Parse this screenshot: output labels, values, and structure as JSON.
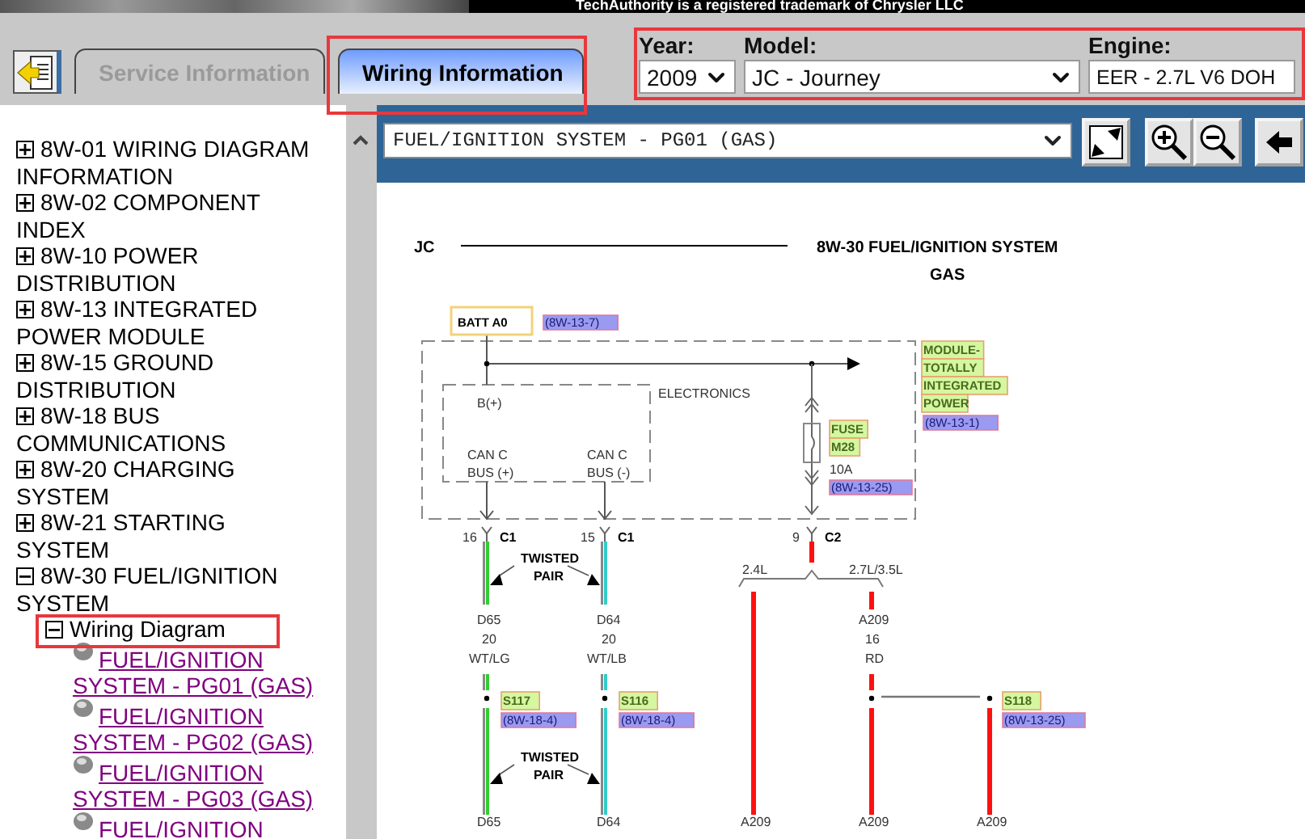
{
  "banner": {
    "notice": "TechAuthority is a registered trademark of Chrysler LLC"
  },
  "tabs": [
    {
      "label": "Service Information",
      "selected": false
    },
    {
      "label": "Wiring Information",
      "selected": true
    }
  ],
  "vehicle": {
    "year_label": "Year:",
    "year": "2009",
    "model_label": "Model:",
    "model": "JC - Journey",
    "engine_label": "Engine:",
    "engine": "EER - 2.7L V6 DOH"
  },
  "tree": [
    {
      "kind": "folder",
      "label": "8W-01 WIRING DIAGRAM INFORMATION",
      "expanded": false
    },
    {
      "kind": "folder",
      "label": "8W-02 COMPONENT INDEX",
      "expanded": false
    },
    {
      "kind": "folder",
      "label": "8W-10 POWER DISTRIBUTION",
      "expanded": false
    },
    {
      "kind": "folder",
      "label": "8W-13 INTEGRATED POWER MODULE",
      "expanded": false
    },
    {
      "kind": "folder",
      "label": "8W-15 GROUND DISTRIBUTION",
      "expanded": false
    },
    {
      "kind": "folder",
      "label": "8W-18 BUS COMMUNICATIONS",
      "expanded": false
    },
    {
      "kind": "folder",
      "label": "8W-20 CHARGING SYSTEM",
      "expanded": false
    },
    {
      "kind": "folder",
      "label": "8W-21 STARTING SYSTEM",
      "expanded": false
    },
    {
      "kind": "folder",
      "label": "8W-30 FUEL/IGNITION SYSTEM",
      "expanded": true,
      "children": [
        {
          "kind": "folder",
          "label": "Wiring Diagram",
          "expanded": true,
          "children": [
            {
              "kind": "page",
              "label": "FUEL/IGNITION SYSTEM - PG01 (GAS)"
            },
            {
              "kind": "page",
              "label": "FUEL/IGNITION SYSTEM - PG02 (GAS)"
            },
            {
              "kind": "page",
              "label": "FUEL/IGNITION SYSTEM - PG03 (GAS)"
            },
            {
              "kind": "page",
              "label": "FUEL/IGNITION"
            }
          ]
        }
      ]
    }
  ],
  "toolbar": {
    "page_select": "FUEL/IGNITION SYSTEM - PG01 (GAS)"
  },
  "diagram": {
    "model_code": "JC",
    "title": "8W-30 FUEL/IGNITION SYSTEM",
    "subtitle": "GAS",
    "labels": [
      {
        "kind": "box",
        "text": "BATT A0"
      },
      {
        "kind": "ref",
        "text": "(8W-13-7)"
      },
      {
        "kind": "plain",
        "text": "ELECTRONICS"
      },
      {
        "kind": "plain",
        "text": "B(+)"
      },
      {
        "kind": "plain",
        "text": "CAN C"
      },
      {
        "kind": "plain",
        "text": "BUS (+)"
      },
      {
        "kind": "plain",
        "text": "CAN C"
      },
      {
        "kind": "plain",
        "text": "BUS (-)"
      },
      {
        "kind": "tag",
        "text": "FUSE"
      },
      {
        "kind": "tag",
        "text": "M28"
      },
      {
        "kind": "plain",
        "text": "10A"
      },
      {
        "kind": "ref",
        "text": "(8W-13-25)"
      },
      {
        "kind": "tag",
        "text": "MODULE-"
      },
      {
        "kind": "tag",
        "text": "TOTALLY"
      },
      {
        "kind": "tag",
        "text": "INTEGRATED"
      },
      {
        "kind": "tag",
        "text": "POWER"
      },
      {
        "kind": "ref",
        "text": "(8W-13-1)"
      },
      {
        "kind": "plain",
        "text": "16"
      },
      {
        "kind": "bold",
        "text": "C1"
      },
      {
        "kind": "plain",
        "text": "15"
      },
      {
        "kind": "bold",
        "text": "C1"
      },
      {
        "kind": "plain",
        "text": "9"
      },
      {
        "kind": "bold",
        "text": "C2"
      },
      {
        "kind": "bold",
        "text": "TWISTED"
      },
      {
        "kind": "bold",
        "text": "PAIR"
      },
      {
        "kind": "plain",
        "text": "2.4L"
      },
      {
        "kind": "plain",
        "text": "2.7L/3.5L"
      },
      {
        "kind": "plain",
        "text": "D65"
      },
      {
        "kind": "plain",
        "text": "20"
      },
      {
        "kind": "plain",
        "text": "WT/LG"
      },
      {
        "kind": "plain",
        "text": "D64"
      },
      {
        "kind": "plain",
        "text": "20"
      },
      {
        "kind": "plain",
        "text": "WT/LB"
      },
      {
        "kind": "plain",
        "text": "A209"
      },
      {
        "kind": "plain",
        "text": "16"
      },
      {
        "kind": "plain",
        "text": "RD"
      },
      {
        "kind": "tag",
        "text": "S117"
      },
      {
        "kind": "tag",
        "text": "S116"
      },
      {
        "kind": "tag",
        "text": "S118"
      },
      {
        "kind": "ref",
        "text": "(8W-18-4)"
      },
      {
        "kind": "ref",
        "text": "(8W-18-4)"
      },
      {
        "kind": "ref",
        "text": "(8W-13-25)"
      },
      {
        "kind": "bold",
        "text": "TWISTED"
      },
      {
        "kind": "bold",
        "text": "PAIR"
      },
      {
        "kind": "plain",
        "text": "D65"
      },
      {
        "kind": "plain",
        "text": "D64"
      },
      {
        "kind": "plain",
        "text": "A209"
      },
      {
        "kind": "plain",
        "text": "A209"
      },
      {
        "kind": "plain",
        "text": "A209"
      }
    ]
  }
}
